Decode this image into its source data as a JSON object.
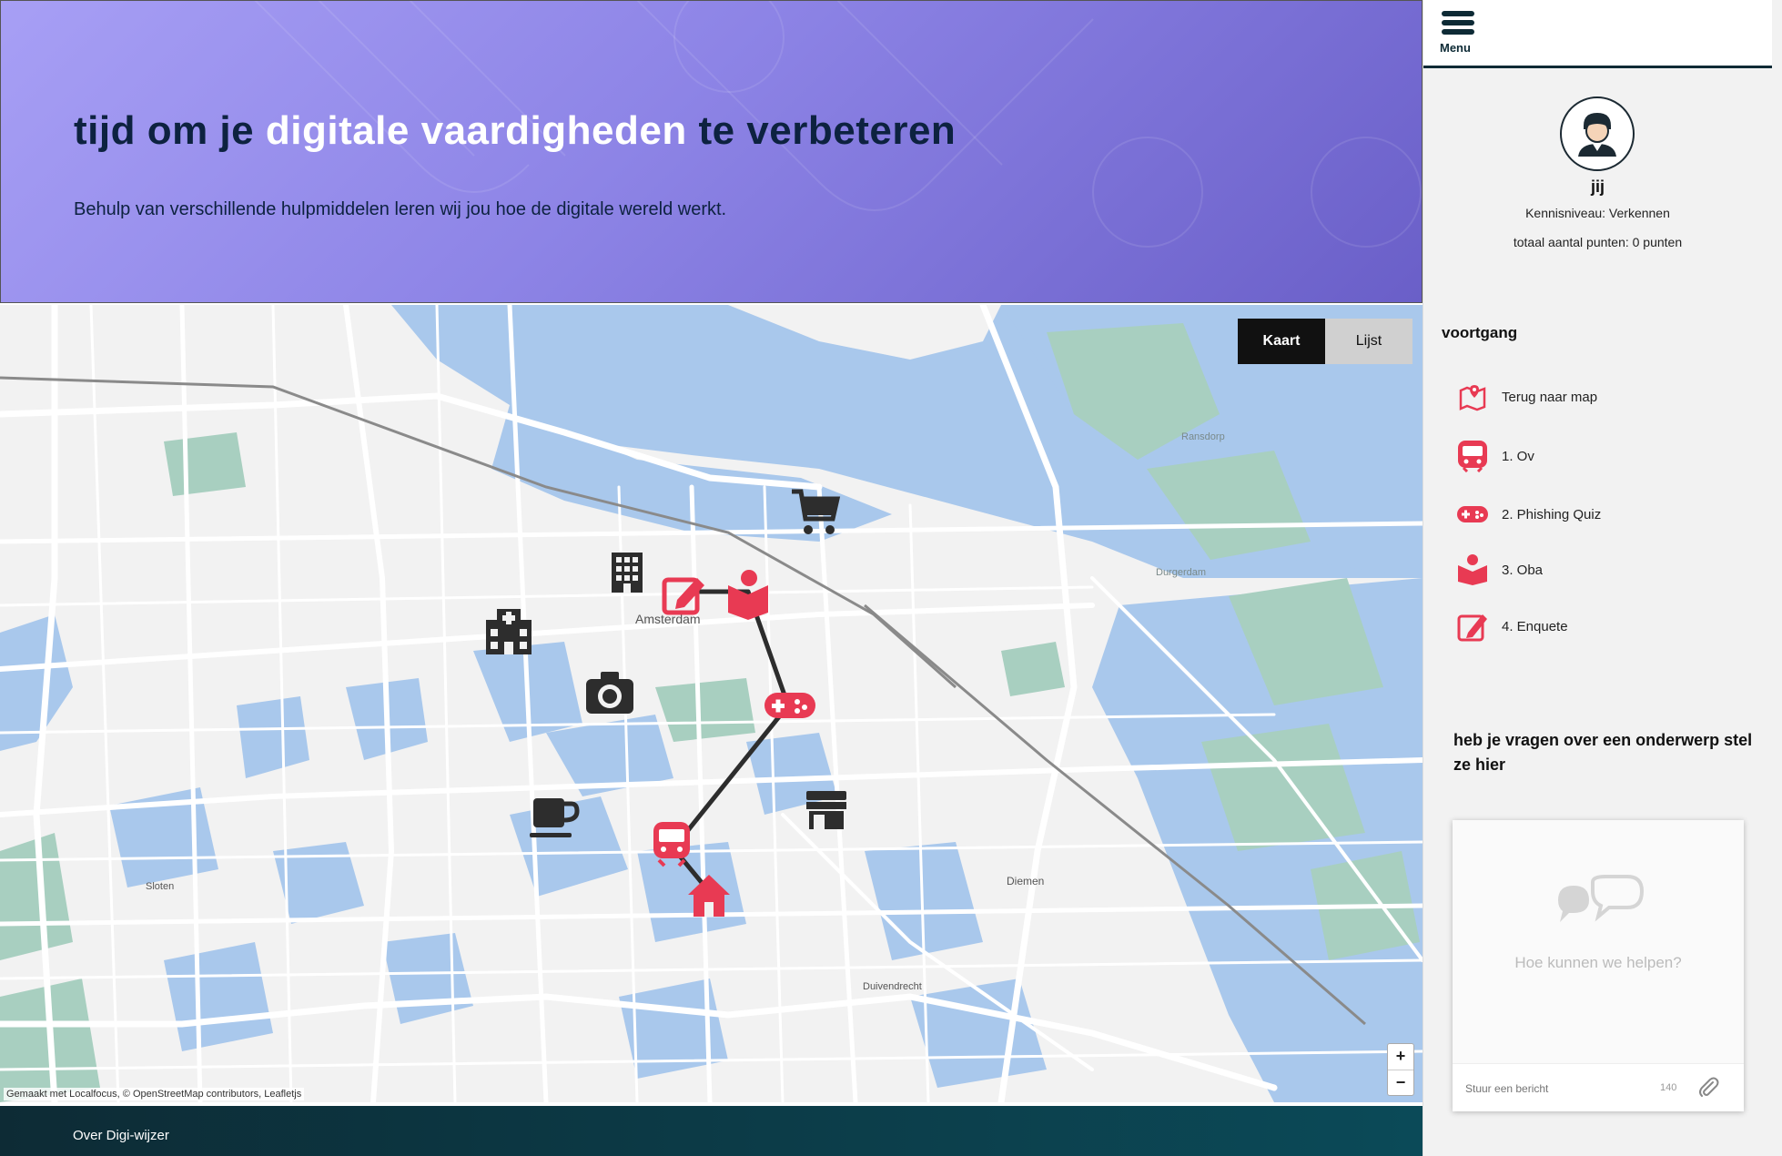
{
  "hero": {
    "title_part1": "tijd om je",
    "title_highlight": "digitale vaardigheden",
    "title_part2": "te verbeteren",
    "subtitle": "Behulp van verschillende hulpmiddelen leren wij jou hoe de digitale wereld werkt."
  },
  "map": {
    "toggle": {
      "kaart": "Kaart",
      "lijst": "Lijst",
      "active": "Kaart"
    },
    "labels": [
      "Amsterdam",
      "Ransdorp",
      "Durgerdam",
      "Sloten",
      "Diemen",
      "Duivendrecht"
    ],
    "markers": [
      "shopping-cart-icon",
      "building-icon",
      "edit-icon",
      "book-reader-icon",
      "hospital-icon",
      "camera-icon",
      "gamepad-icon",
      "coffee-icon",
      "store-icon",
      "train-icon",
      "home-icon"
    ],
    "zoom_in": "+",
    "zoom_out": "−",
    "attribution": "Gemaakt met Localfocus, © OpenStreetMap contributors, Leafletjs",
    "colors": {
      "water": "#a9c8ec",
      "land": "#f2f2f2",
      "park": "#a8cfc0",
      "roads": "#ffffff",
      "accent_marker": "#e83a53",
      "dark_marker": "#2d2d2d",
      "route": "#2d2d2d"
    }
  },
  "footer": {
    "link": "Over Digi-wijzer"
  },
  "sidebar": {
    "menu_label": "Menu",
    "user": {
      "name": "jij",
      "level": "Kennisniveau: Verkennen",
      "points": "totaal aantal punten: 0 punten"
    },
    "progress_title": "voortgang",
    "progress_items": [
      {
        "label": "Terug naar map",
        "icon": "map-marker-icon"
      },
      {
        "label": "1. Ov",
        "icon": "train-icon"
      },
      {
        "label": "2. Phishing Quiz",
        "icon": "gamepad-icon"
      },
      {
        "label": "3. Oba",
        "icon": "book-reader-icon"
      },
      {
        "label": "4. Enquete",
        "icon": "edit-icon"
      }
    ],
    "questions_title": "heb je vragen over een onderwerp stel ze hier",
    "chat": {
      "message": "Hoe kunnen we helpen?",
      "placeholder": "Stuur een bericht",
      "char_count": "140"
    }
  }
}
